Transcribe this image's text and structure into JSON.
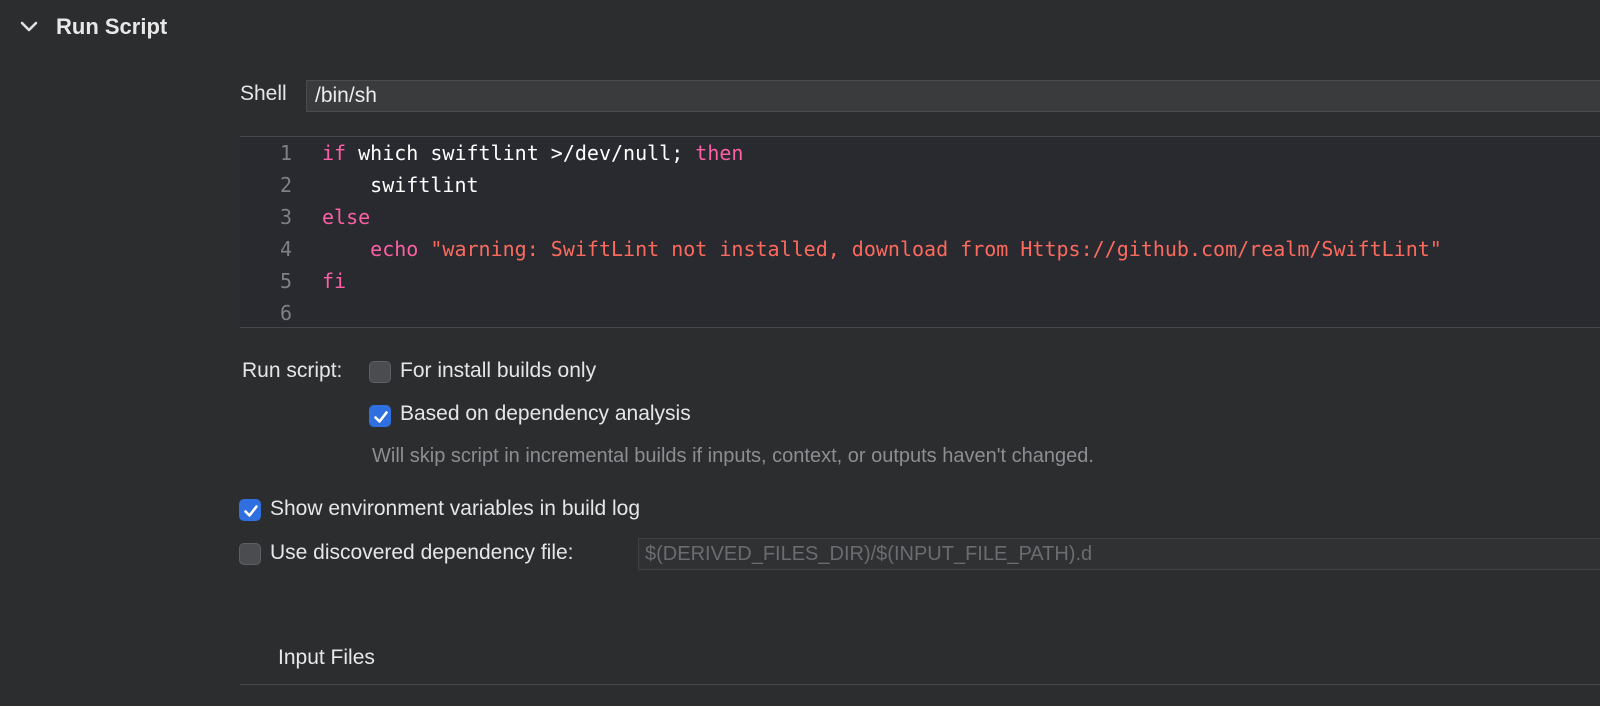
{
  "section": {
    "title": "Run Script",
    "icon": "chevron-down-icon"
  },
  "shell": {
    "label": "Shell",
    "value": "/bin/sh"
  },
  "editor": {
    "lines": [
      {
        "n": "1",
        "parts": [
          {
            "t": "if",
            "c": "kw"
          },
          {
            "t": " which swiftlint >/dev/null; ",
            "c": "pl"
          },
          {
            "t": "then",
            "c": "kw"
          }
        ]
      },
      {
        "n": "2",
        "parts": [
          {
            "t": "    swiftlint",
            "c": "pl"
          }
        ]
      },
      {
        "n": "3",
        "parts": [
          {
            "t": "else",
            "c": "kw"
          }
        ]
      },
      {
        "n": "4",
        "parts": [
          {
            "t": "    echo ",
            "c": "kw"
          },
          {
            "t": "\"warning: SwiftLint not installed, download from Https://github.com/realm/SwiftLint\"",
            "c": "str"
          }
        ]
      },
      {
        "n": "5",
        "parts": [
          {
            "t": "fi",
            "c": "kw"
          }
        ]
      },
      {
        "n": "6",
        "parts": []
      }
    ]
  },
  "run_script": {
    "label": "Run script:",
    "install_builds_only": {
      "label": "For install builds only",
      "checked": false
    },
    "dependency_analysis": {
      "label": "Based on dependency analysis",
      "checked": true
    },
    "hint": "Will skip script in incremental builds if inputs, context, or outputs haven't changed."
  },
  "show_env": {
    "label": "Show environment variables in build log",
    "checked": true
  },
  "dep_file": {
    "label": "Use discovered dependency file:",
    "checked": false,
    "placeholder": "$(DERIVED_FILES_DIR)/$(INPUT_FILE_PATH).d"
  },
  "input_files": {
    "title": "Input Files"
  },
  "colors": {
    "background": "#2b2d2f",
    "keyword": "#fc5fa3",
    "string": "#fc6a5d",
    "checkbox_checked": "#2f6fe0"
  }
}
